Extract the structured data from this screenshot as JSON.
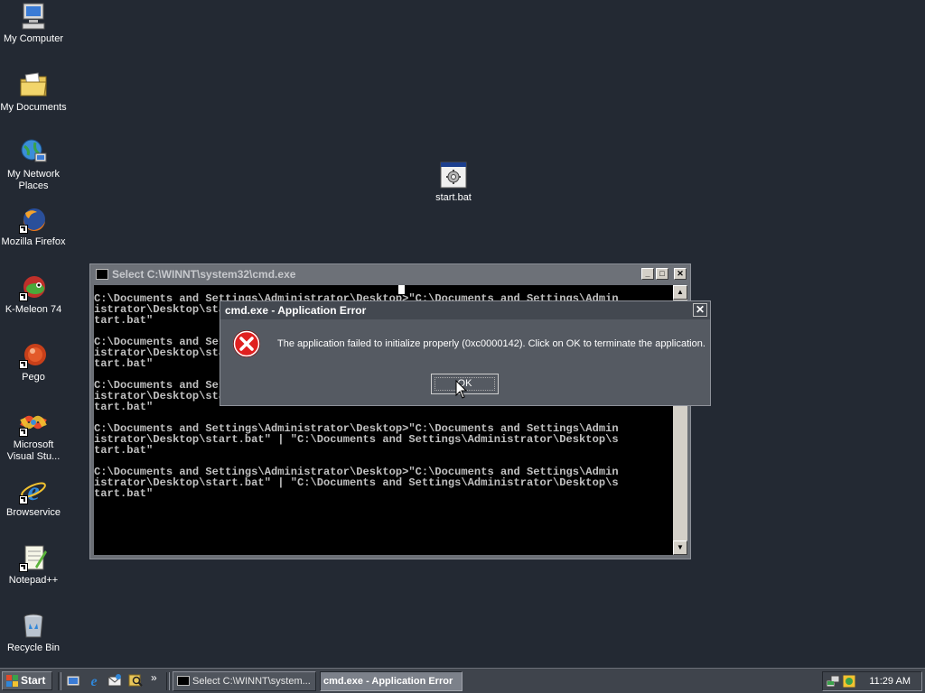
{
  "desktop": {
    "icons": [
      {
        "label": "My Computer"
      },
      {
        "label": "My Documents"
      },
      {
        "label": "My Network Places"
      },
      {
        "label": "Mozilla Firefox"
      },
      {
        "label": "K-Meleon 74"
      },
      {
        "label": "Pego"
      },
      {
        "label": "Microsoft Visual Stu..."
      },
      {
        "label": "Browservice"
      },
      {
        "label": "Notepad++"
      },
      {
        "label": "Recycle Bin"
      },
      {
        "label": "start.bat"
      }
    ]
  },
  "cmd_window": {
    "title": "Select C:\\WINNT\\system32\\cmd.exe",
    "console_text": "C:\\Documents and Settings\\Administrator\\Desktop>\"C:\\Documents and Settings\\Admin\nistrator\\Desktop\\start.bat\" | \"C:\\Documents and Settings\\Administrator\\Desktop\\s\ntart.bat\"\n\nC:\\Documents and Settings\\Administrator\\Desktop>\"C:\\Documents and Settings\\Admin\nistrator\\Desktop\\start.bat\" | \"C:\\Documents and Settings\\Administrator\\Desktop\\s\ntart.bat\"\n\nC:\\Documents and Settings\\Administrator\\Desktop>\"C:\\Documents and Settings\\Admin\nistrator\\Desktop\\start.bat\" | \"C:\\Documents and Settings\\Administrator\\Desktop\\s\ntart.bat\"\n\nC:\\Documents and Settings\\Administrator\\Desktop>\"C:\\Documents and Settings\\Admin\nistrator\\Desktop\\start.bat\" | \"C:\\Documents and Settings\\Administrator\\Desktop\\s\ntart.bat\"\n\nC:\\Documents and Settings\\Administrator\\Desktop>\"C:\\Documents and Settings\\Admin\nistrator\\Desktop\\start.bat\" | \"C:\\Documents and Settings\\Administrator\\Desktop\\s\ntart.bat\""
  },
  "error_dialog": {
    "title": "cmd.exe - Application Error",
    "message": "The application failed to initialize properly (0xc0000142). Click on OK to terminate the application.",
    "ok_label": "OK",
    "close_glyph": "✕"
  },
  "taskbar": {
    "start_label": "Start",
    "tasks": [
      {
        "label": "Select C:\\WINNT\\system..."
      },
      {
        "label": "cmd.exe - Application Error"
      }
    ],
    "clock": "11:29 AM",
    "quicklaunch_more": "»"
  },
  "colors": {
    "desktop_bg": "#232933",
    "error_red": "#e02020"
  }
}
